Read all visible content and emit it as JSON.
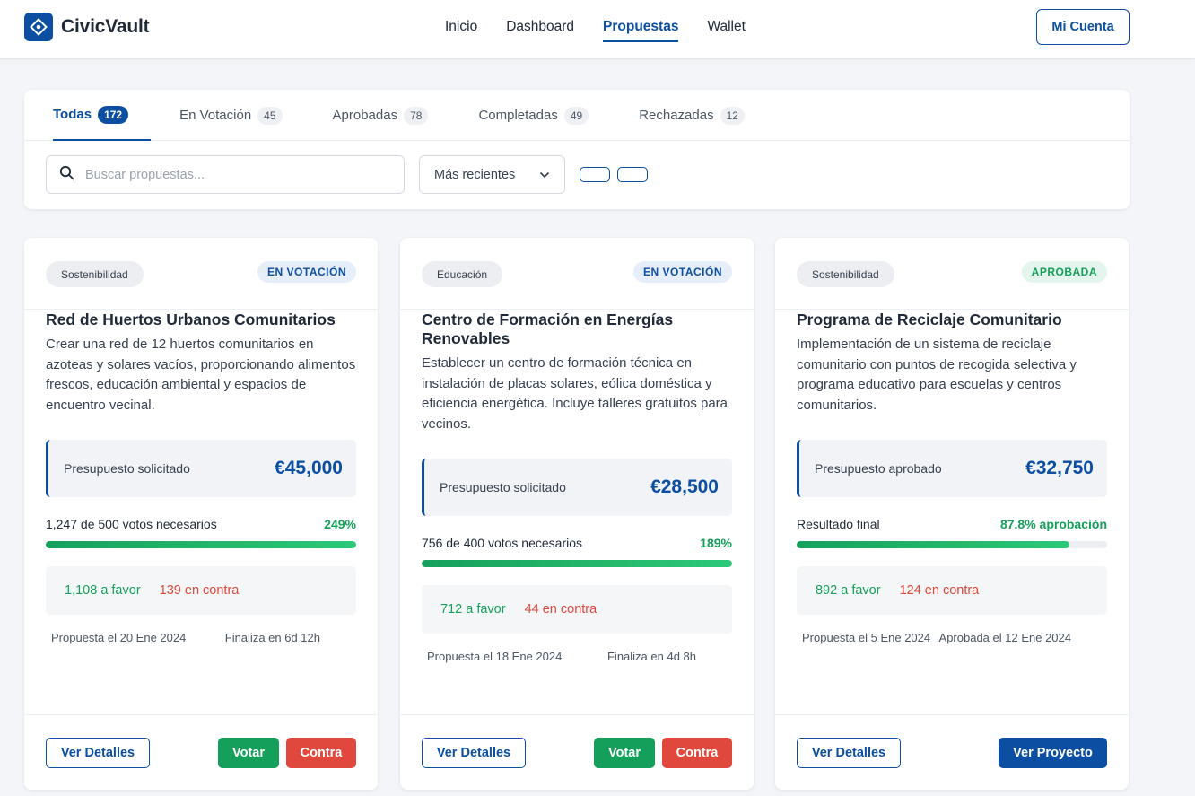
{
  "header": {
    "brand": "CivicVault",
    "nav": [
      "Inicio",
      "Dashboard",
      "Propuestas",
      "Wallet"
    ],
    "nav_active": "Propuestas",
    "account_label": "Mi Cuenta"
  },
  "tabs": [
    {
      "label": "Todas",
      "count": "172"
    },
    {
      "label": "En Votación",
      "count": "45"
    },
    {
      "label": "Aprobadas",
      "count": "78"
    },
    {
      "label": "Completadas",
      "count": "49"
    },
    {
      "label": "Rechazadas",
      "count": "12"
    }
  ],
  "search": {
    "placeholder": "Buscar propuestas...",
    "value": ""
  },
  "sort": {
    "selected": "Más recientes"
  },
  "cards": [
    {
      "category": "Sostenibilidad",
      "status": "EN VOTACIÓN",
      "title": "Red de Huertos Urbanos Comunitarios",
      "description": "Crear una red de 12 huertos comunitarios en azoteas y solares vacíos, proporcionando alimentos frescos, educación ambiental y espacios de encuentro vecinal.",
      "budget_label": "Presupuesto solicitado",
      "budget_amount": "€45,000",
      "progress_text": "1,247 de 500 votos necesarios",
      "progress_pct": "249%",
      "progress_fill": 1.0,
      "favor": "1,108 a favor",
      "contra": "139 en contra",
      "date_left": "Propuesta el 20 Ene 2024",
      "date_right": "Finaliza en 6d 12h",
      "btn_details": "Ver Detalles",
      "btn_vote": "Votar",
      "btn_against": "Contra"
    },
    {
      "category": "Educación",
      "status": "EN VOTACIÓN",
      "title": "Centro de Formación en Energías Renovables",
      "description": "Establecer un centro de formación técnica en instalación de placas solares, eólica doméstica y eficiencia energética. Incluye talleres gratuitos para vecinos.",
      "budget_label": "Presupuesto solicitado",
      "budget_amount": "€28,500",
      "progress_text": "756 de 400 votos necesarios",
      "progress_pct": "189%",
      "progress_fill": 1.0,
      "favor": "712 a favor",
      "contra": "44 en contra",
      "date_left": "Propuesta el 18 Ene 2024",
      "date_right": "Finaliza en 4d 8h",
      "btn_details": "Ver Detalles",
      "btn_vote": "Votar",
      "btn_against": "Contra"
    },
    {
      "category": "Sostenibilidad",
      "status": "APROBADA",
      "title": "Programa de Reciclaje Comunitario",
      "description": "Implementación de un sistema de reciclaje comunitario con puntos de recogida selectiva y programa educativo para escuelas y centros comunitarios.",
      "budget_label": "Presupuesto aprobado",
      "budget_amount": "€32,750",
      "progress_text": "Resultado final",
      "progress_pct": "87.8% aprobación",
      "progress_fill": 0.878,
      "favor": "892 a favor",
      "contra": "124 en contra",
      "date_left": "Propuesta el 5 Ene 2024",
      "date_right": "Aprobada el 12 Ene 2024",
      "btn_details": "Ver Detalles",
      "btn_project": "Ver Proyecto"
    }
  ],
  "colors": {
    "primary": "#0b4ea2",
    "success": "#15a05a",
    "danger": "#e0483d",
    "background": "#f3f5f8"
  },
  "icons": {
    "brand": "diamond-logo-icon",
    "search": "search-icon",
    "sort": "chevron-down-icon"
  }
}
